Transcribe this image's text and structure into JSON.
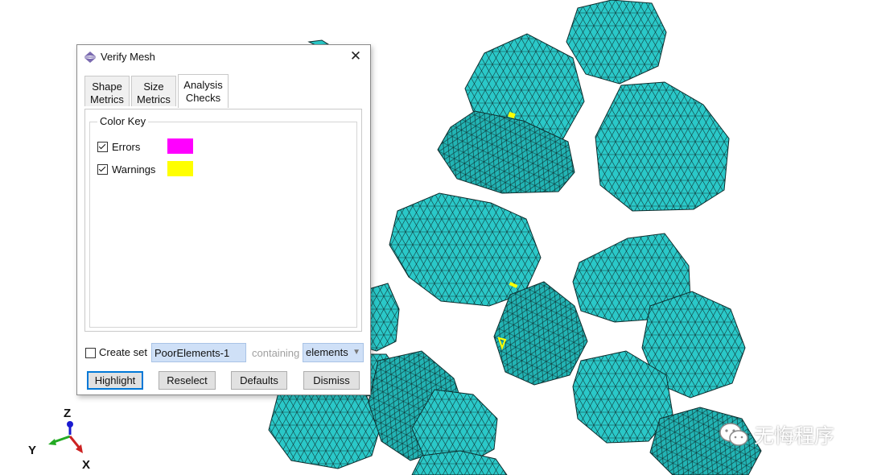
{
  "dialog": {
    "title": "Verify Mesh",
    "close_symbol": "✕",
    "tabs": [
      {
        "label_line1": "Shape",
        "label_line2": "Metrics"
      },
      {
        "label_line1": "Size",
        "label_line2": "Metrics"
      },
      {
        "label_line1": "Analysis",
        "label_line2": "Checks"
      }
    ],
    "active_tab": "Analysis Checks",
    "color_key": {
      "legend": "Color Key",
      "items": [
        {
          "label": "Errors",
          "checked": true,
          "color": "#ff00ff"
        },
        {
          "label": "Warnings",
          "checked": true,
          "color": "#ffff00"
        }
      ]
    },
    "create_set": {
      "label": "Create set",
      "checked": false,
      "set_name": "PoorElements-1",
      "containing_label": "containing",
      "containing_value": "elements"
    },
    "buttons": {
      "highlight": "Highlight",
      "reselect": "Reselect",
      "defaults": "Defaults",
      "dismiss": "Dismiss"
    }
  },
  "viewport": {
    "mesh_color": "#2ac8c8",
    "edge_color": "#0d2d2d",
    "warning_marker_color": "#ffff00"
  },
  "triad": {
    "z": "Z",
    "y": "Y",
    "x": "X"
  },
  "watermark": {
    "text": "无悔程序",
    "icon": "wechat-icon"
  }
}
